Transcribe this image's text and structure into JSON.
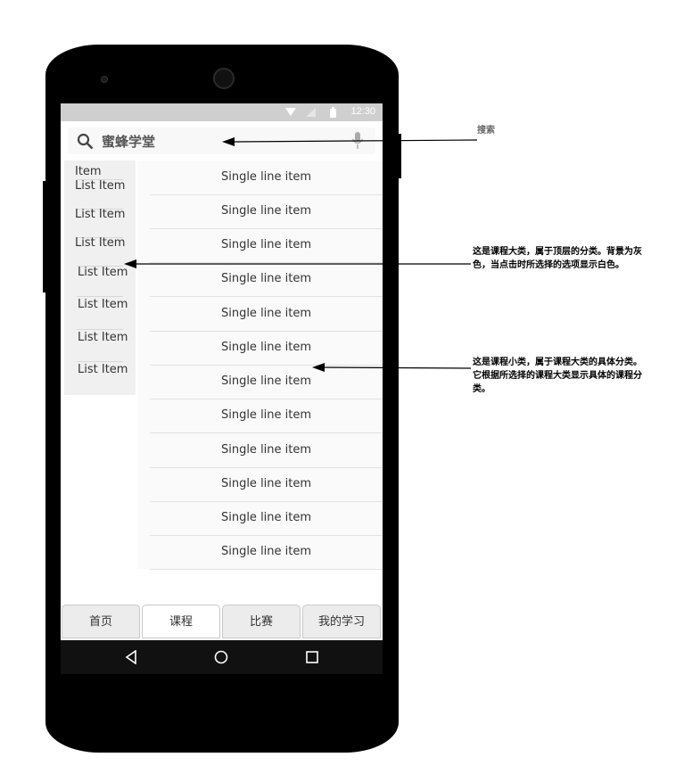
{
  "status_bar": {
    "time": "12:30"
  },
  "search": {
    "text": "蜜蜂学堂"
  },
  "categories": [
    "Item",
    "List Item",
    "List Item",
    "List Item",
    "List Item",
    "List Item",
    "List Item",
    "List Item"
  ],
  "sub_items": [
    "Single line item",
    "Single line item",
    "Single line item",
    "Single line item",
    "Single line item",
    "Single line item",
    "Single line item",
    "Single line item",
    "Single line item",
    "Single line item",
    "Single line item",
    "Single line item"
  ],
  "tabs": [
    {
      "label": "首页",
      "active": false
    },
    {
      "label": "课程",
      "active": true
    },
    {
      "label": "比赛",
      "active": false
    },
    {
      "label": "我的学习",
      "active": false
    }
  ],
  "annotations": {
    "search": "搜索",
    "category": "这是课程大类，属于顶层的分类。背景为灰色，当点击时所选择的选项显示白色。",
    "subcategory": "这是课程小类，属于课程大类的具体分类。它根据所选择的课程大类显示具体的课程分类。"
  }
}
